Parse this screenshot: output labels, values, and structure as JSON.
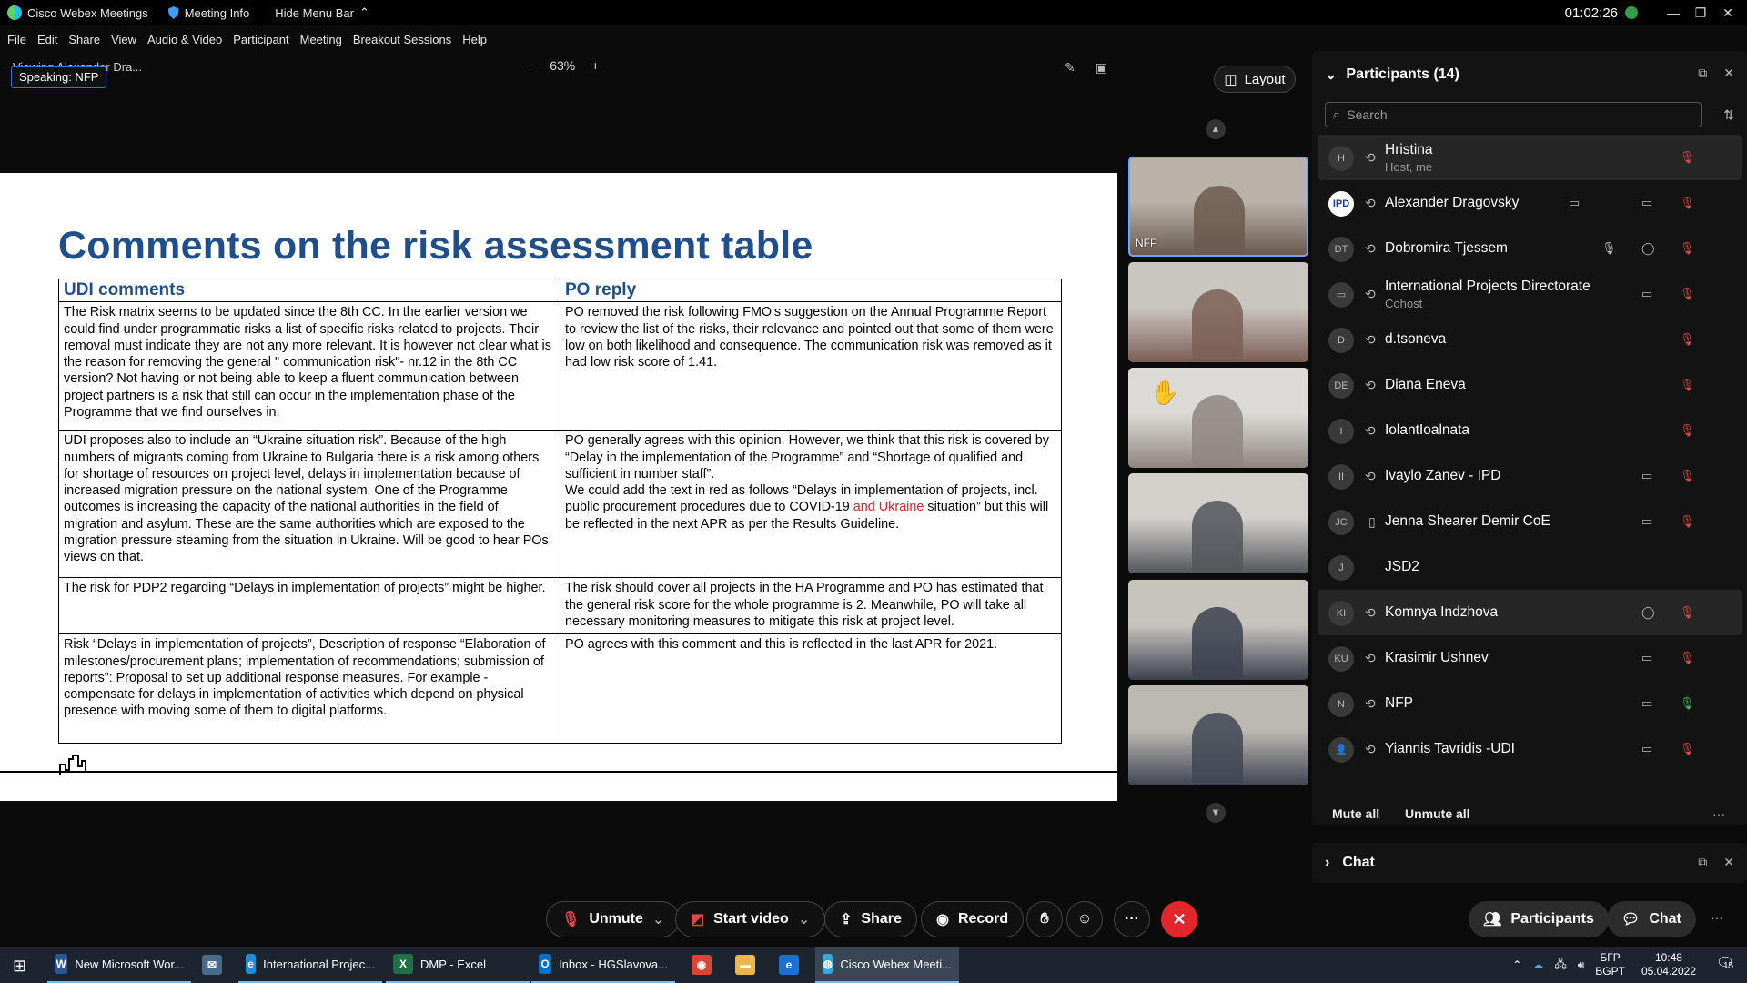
{
  "titlebar": {
    "app_name": "Cisco Webex Meetings",
    "meeting_info": "Meeting Info",
    "hide_menu": "Hide Menu Bar",
    "timer": "01:02:26",
    "minimize": "—",
    "restore": "❐",
    "close": "✕"
  },
  "menu": [
    "File",
    "Edit",
    "Share",
    "View",
    "Audio & Video",
    "Participant",
    "Meeting",
    "Breakout Sessions",
    "Help"
  ],
  "share_bar": {
    "viewing": "Viewing Alexander Dra...",
    "speaking": "Speaking: NFP",
    "zoom_out": "−",
    "zoom_level": "63%",
    "zoom_in": "+"
  },
  "slide": {
    "title": "Comments on the risk assessment table",
    "headers": [
      "UDI comments",
      "PO reply"
    ],
    "rows": [
      {
        "udi": "The Risk matrix seems to be updated since the 8th CC. In the earlier version we could find under programmatic risks a list of specific risks related to projects. Their removal must indicate they are not any more relevant. It is however not clear what is the reason for removing the general \" communication risk\"- nr.12 in the 8th CC version? Not having or not being able to keep a fluent communication between project partners is a risk that still can occur in the implementation phase of the Programme that we find ourselves in.",
        "po": "PO removed the risk following FMO's suggestion on the Annual Programme Report to review the list of the risks, their relevance and pointed out that some of them were low on both likelihood and consequence. The communication risk was removed as it had low risk score of 1.41."
      },
      {
        "udi": "UDI proposes also to include an “Ukraine situation risk”.  Because of the high numbers of  migrants coming  from Ukraine to Bulgaria there is a risk among others for shortage of resources on project level, delays in implementation because of increased migration pressure on the national system. One of the Programme outcomes is increasing the capacity of the national authorities in the field of migration and asylum. These are the same authorities which are exposed to the migration pressure steaming from the situation in Ukraine.  Will be good to hear POs views on that.",
        "po_a": "PO generally agrees with this opinion. However, we think that this risk is covered by “Delay in the implementation of the Programme” and “Shortage of qualified and sufficient in number staff”.",
        "po_b": "We could add the text in red as follows “Delays in implementation of projects, incl. public procurement procedures due to COVID-19 ",
        "po_red": "and Ukraine",
        "po_c": " situation” but this will be reflected in the next APR as per the Results Guideline."
      },
      {
        "udi": "The risk for PDP2 regarding “Delays in implementation of projects” might be higher.",
        "po": "The risk should cover all projects in the HA Programme and PO has estimated that the general risk score for the whole programme is 2. Meanwhile, PO will take all necessary monitoring measures to mitigate this risk at project level."
      },
      {
        "udi": "Risk “Delays in implementation of projects”, Description of response “Elaboration of milestones/procurement plans; implementation of recommendations; submission of reports”: Proposal to set up additional response measures. For example - compensate for delays in implementation of activities which depend on physical presence with moving some of them to digital platforms.",
        "po": "PO agrees with this comment and this is reflected in the last APR for 2021."
      }
    ]
  },
  "video": {
    "layout_label": "Layout",
    "tiles": [
      {
        "label": "NFP",
        "active": true,
        "colors": [
          "#b8b2a8",
          "#6b5a4e"
        ]
      },
      {
        "label": "",
        "active": false,
        "colors": [
          "#c9c5bf",
          "#7c5f56"
        ]
      },
      {
        "label": "",
        "active": false,
        "raised_hand": true,
        "colors": [
          "#dcdad6",
          "#8e8680"
        ]
      },
      {
        "label": "",
        "active": false,
        "colors": [
          "#d3d0cc",
          "#54565c"
        ]
      },
      {
        "label": "",
        "active": false,
        "colors": [
          "#c7c3bd",
          "#3d4250"
        ]
      },
      {
        "label": "",
        "active": false,
        "colors": [
          "#bcb8b2",
          "#414654"
        ]
      }
    ]
  },
  "participants_panel": {
    "title": "Participants (14)",
    "search_placeholder": "Search",
    "mute_all": "Mute all",
    "unmute_all": "Unmute all",
    "more": "···",
    "people": [
      {
        "initials": "H",
        "name": "Hristina",
        "sub": "Host, me",
        "video": false,
        "mic": "off",
        "highlight": true
      },
      {
        "initials": "IPD",
        "name": "Alexander Dragovsky",
        "sub": "",
        "video": true,
        "mic": "off",
        "share": true,
        "logo": true
      },
      {
        "initials": "DT",
        "name": "Dobromira Tjessem",
        "sub": "",
        "video": false,
        "mic": "off",
        "chat": true,
        "muted_host": true
      },
      {
        "initials": "▭",
        "name": "International Projects Directorate",
        "sub": "Cohost",
        "video": true,
        "mic": "off"
      },
      {
        "initials": "D",
        "name": "d.tsoneva",
        "sub": "",
        "video": false,
        "mic": "off"
      },
      {
        "initials": "DE",
        "name": "Diana Eneva",
        "sub": "",
        "video": false,
        "mic": "off"
      },
      {
        "initials": "I",
        "name": "IolantIoalnata",
        "sub": "",
        "video": false,
        "mic": "off"
      },
      {
        "initials": "II",
        "name": "Ivaylo Zanev - IPD",
        "sub": "",
        "video": true,
        "mic": "off"
      },
      {
        "initials": "JC",
        "name": "Jenna Shearer Demir CoE",
        "sub": "",
        "video": true,
        "mic": "off",
        "phone": true
      },
      {
        "initials": "J",
        "name": "JSD2",
        "sub": "",
        "video": false,
        "mic": "none",
        "nosync": true
      },
      {
        "initials": "KI",
        "name": "Komnya Indzhova",
        "sub": "",
        "video": false,
        "mic": "off",
        "chat": true,
        "highlight": true
      },
      {
        "initials": "KU",
        "name": "Krasimir Ushnev",
        "sub": "",
        "video": true,
        "mic": "off"
      },
      {
        "initials": "N",
        "name": "NFP",
        "sub": "",
        "video": true,
        "mic": "on"
      },
      {
        "initials": "👤",
        "name": "Yiannis Tavridis -UDI",
        "sub": "",
        "video": true,
        "mic": "off"
      }
    ]
  },
  "chat_panel": {
    "title": "Chat"
  },
  "controls": {
    "unmute": "Unmute",
    "start_video": "Start video",
    "share": "Share",
    "record": "Record",
    "more": "···",
    "participants": "Participants",
    "chat": "Chat"
  },
  "taskbar": {
    "apps": [
      {
        "label": "New Microsoft Wor...",
        "icon": "W",
        "color": "#2b5797"
      },
      {
        "label": "",
        "icon": "✉",
        "color": "#4a6a8a"
      },
      {
        "label": "International Projec...",
        "icon": "e",
        "color": "#1a8fd8"
      },
      {
        "label": "DMP - Excel",
        "icon": "X",
        "color": "#1e7145"
      },
      {
        "label": "Inbox - HGSlavova...",
        "icon": "O",
        "color": "#0072c6"
      },
      {
        "label": "",
        "icon": "◉",
        "color": "#db4437"
      },
      {
        "label": "",
        "icon": "▬",
        "color": "#e8b84a"
      },
      {
        "label": "",
        "icon": "e",
        "color": "#1d6fd1"
      },
      {
        "label": "Cisco Webex Meeti...",
        "icon": "◍",
        "color": "#2faadc"
      }
    ],
    "lang_top": "БГР",
    "lang_bottom": "BGPT",
    "time": "10:48",
    "date": "05.04.2022",
    "notif": "15"
  }
}
